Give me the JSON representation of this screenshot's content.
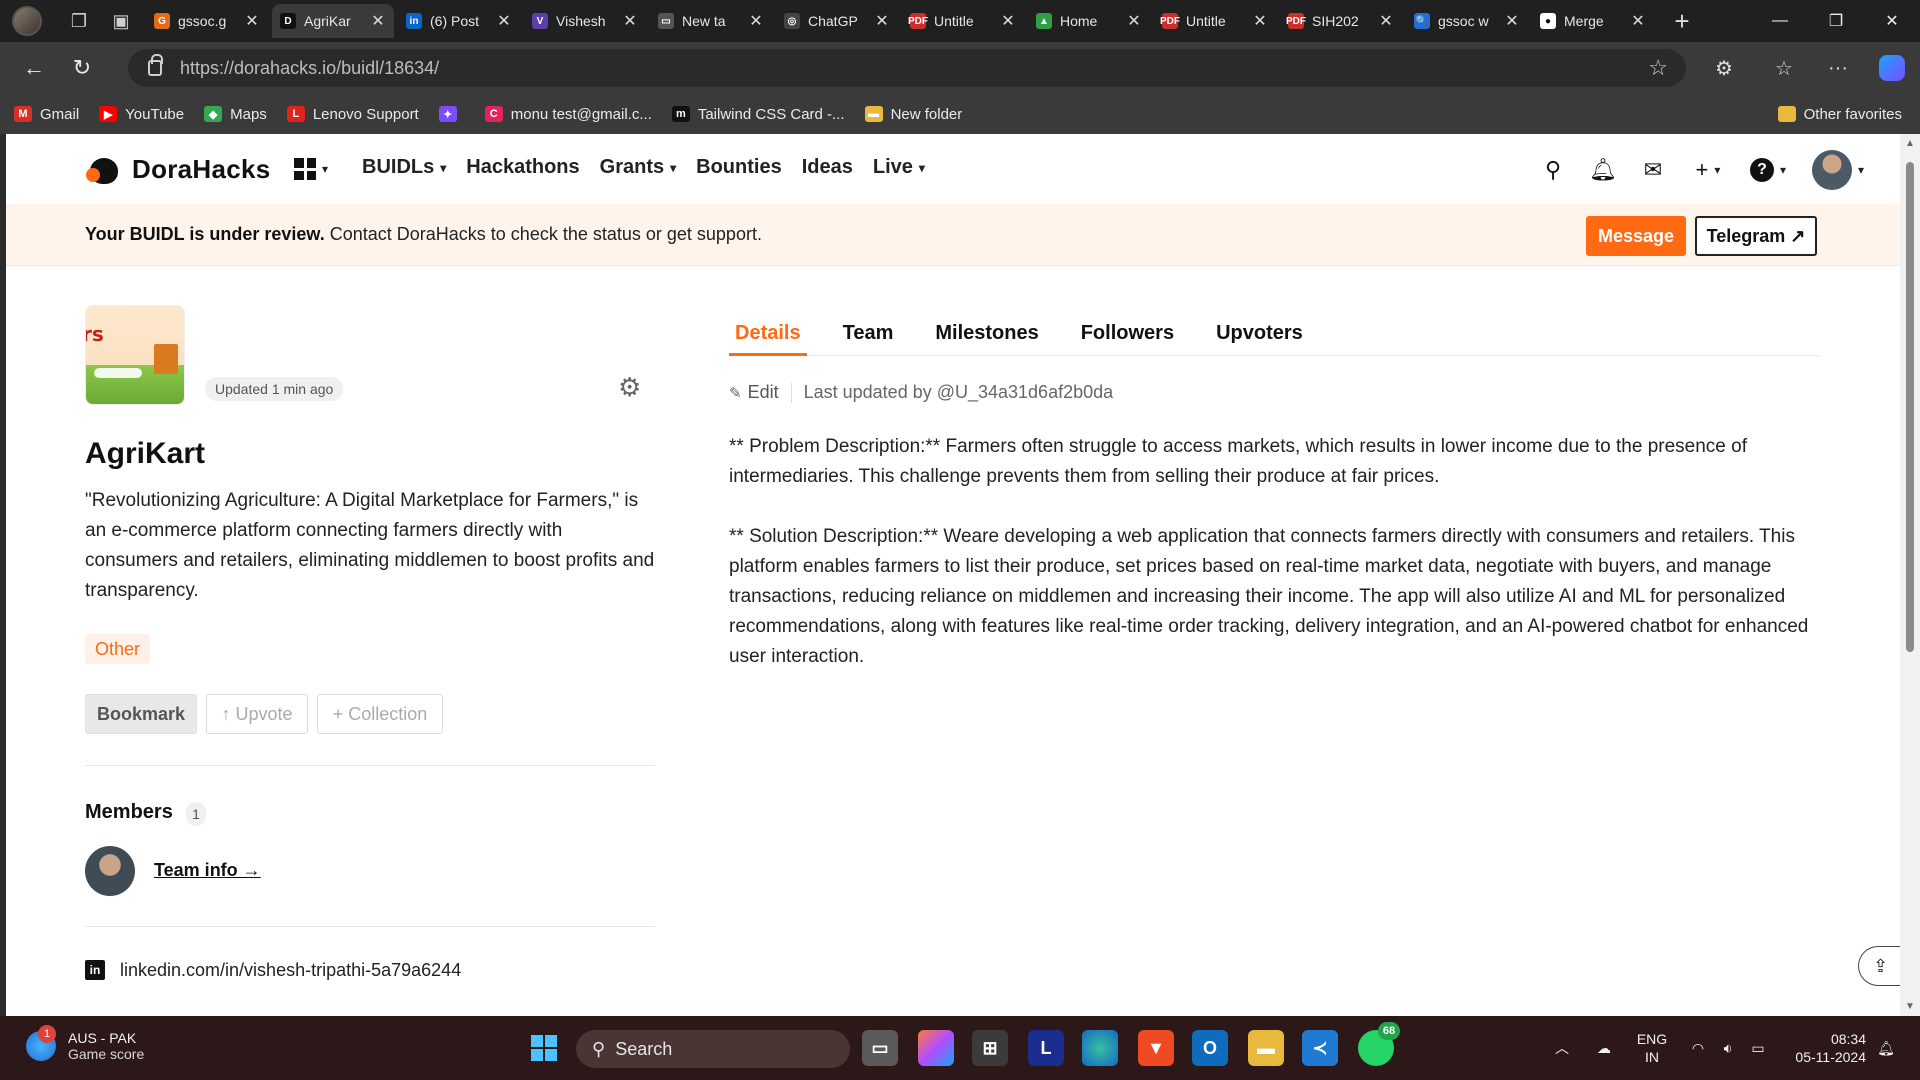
{
  "browser": {
    "tabs": [
      {
        "title": "gssoc.g",
        "fav_color": "#e06b1a",
        "fav_text": "G"
      },
      {
        "title": "AgriKar",
        "fav_color": "#111111",
        "fav_text": "D",
        "active": true
      },
      {
        "title": "(6) Post",
        "fav_color": "#0a66c2",
        "fav_text": "in"
      },
      {
        "title": "Vishesh",
        "fav_color": "#5b3fa8",
        "fav_text": "V"
      },
      {
        "title": "New ta",
        "fav_color": "#555555",
        "fav_text": "▭"
      },
      {
        "title": "ChatGP",
        "fav_color": "#444444",
        "fav_text": "◎"
      },
      {
        "title": "Untitle",
        "fav_color": "#c9302c",
        "fav_text": "PDF"
      },
      {
        "title": "Home",
        "fav_color": "#2f9e44",
        "fav_text": "▲"
      },
      {
        "title": "Untitle",
        "fav_color": "#c9302c",
        "fav_text": "PDF"
      },
      {
        "title": "SIH202",
        "fav_color": "#c9302c",
        "fav_text": "PDF"
      },
      {
        "title": "gssoc w",
        "fav_color": "#1f6fd6",
        "fav_text": "🔍"
      },
      {
        "title": "Merge",
        "fav_color": "#ffffff",
        "fav_text": "●"
      }
    ],
    "url": "https://dorahacks.io/buidl/18634/",
    "bookmarks": [
      {
        "label": "Gmail",
        "color": "#d93025",
        "icon": "M"
      },
      {
        "label": "YouTube",
        "color": "#ff0000",
        "icon": "▶"
      },
      {
        "label": "Maps",
        "color": "#34a853",
        "icon": "◆"
      },
      {
        "label": "Lenovo Support",
        "color": "#e2231a",
        "icon": "L"
      },
      {
        "label": "",
        "color": "#7b4dff",
        "icon": "✦"
      },
      {
        "label": "monu test@gmail.c...",
        "color": "#e2245a",
        "icon": "C"
      },
      {
        "label": "Tailwind CSS Card -...",
        "color": "#111111",
        "icon": "m"
      },
      {
        "label": "New folder",
        "color": "#e8b93c",
        "icon": "▬"
      }
    ],
    "other_favorites": "Other favorites"
  },
  "site": {
    "brand": "DoraHacks",
    "nav": [
      "BUIDLs",
      "Hackathons",
      "Grants",
      "Bounties",
      "Ideas",
      "Live"
    ],
    "nav_dropdowns": [
      true,
      false,
      true,
      false,
      false,
      true
    ]
  },
  "banner": {
    "bold": "Your BUIDL is under review.",
    "text": " Contact DoraHacks to check the status or get support.",
    "message_btn": "Message",
    "telegram_btn": "Telegram ↗",
    "accent": "#ff6a13"
  },
  "project": {
    "thumb_text": "rs",
    "updated": "Updated 1 min ago",
    "name": "AgriKart",
    "description": "\"Revolutionizing Agriculture: A Digital Marketplace for Farmers,\" is an e-commerce platform connecting farmers directly with consumers and retailers, eliminating middlemen to boost profits and transparency.",
    "tag": "Other",
    "bookmark": "Bookmark",
    "upvote": "↑ Upvote",
    "collection": "+ Collection",
    "members_title": "Members",
    "members_count": "1",
    "team_info": "Team info →",
    "linkedin": "linkedin.com/in/vishesh-tripathi-5a79a6244"
  },
  "details": {
    "tabs": [
      "Details",
      "Team",
      "Milestones",
      "Followers",
      "Upvoters"
    ],
    "active_tab": "Details",
    "edit": "Edit",
    "last_updated": "Last updated by @U_34a31d6af2b0da",
    "paragraphs": [
      "** Problem Description:** Farmers often struggle to access markets, which results in lower income due to the presence of intermediaries. This challenge prevents them from selling their produce at fair prices.",
      "** Solution Description:** Weare developing a web application that connects farmers directly with consumers and retailers. This platform enables farmers to list their produce, set prices based on real-time market data, negotiate with buyers, and manage transactions, reducing reliance on middlemen and increasing their income. The app will also utilize AI and ML for personalized recommendations, along with features like real-time order tracking, delivery integration, and an AI-powered chatbot for enhanced user interaction."
    ]
  },
  "taskbar": {
    "weather_title": "AUS - PAK",
    "weather_sub": "Game score",
    "weather_badge": "1",
    "search": "Search",
    "whatsapp_badge": "68",
    "lang1": "ENG",
    "lang2": "IN",
    "time": "08:34",
    "date": "05-11-2024"
  }
}
